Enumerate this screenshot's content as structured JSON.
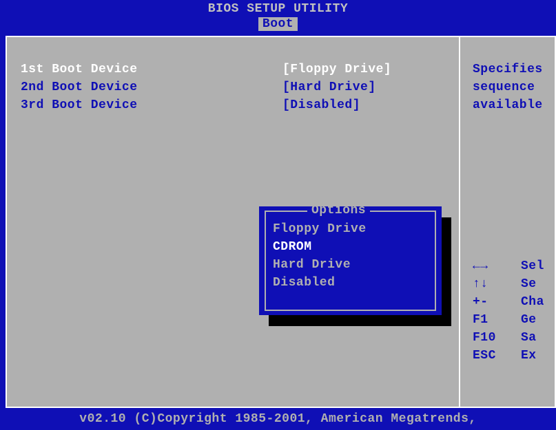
{
  "header": {
    "title": "BIOS SETUP UTILITY",
    "active_tab": "Boot"
  },
  "boot_devices": [
    {
      "label": "1st Boot Device",
      "value": "[Floppy Drive]",
      "selected": true
    },
    {
      "label": "2nd Boot Device",
      "value": "[Hard Drive]",
      "selected": false
    },
    {
      "label": "3rd Boot Device",
      "value": "[Disabled]",
      "selected": false
    }
  ],
  "options_popup": {
    "title": "Options",
    "items": [
      {
        "label": "Floppy Drive",
        "selected": false
      },
      {
        "label": "CDROM",
        "selected": true
      },
      {
        "label": "Hard Drive",
        "selected": false
      },
      {
        "label": "Disabled",
        "selected": false
      }
    ]
  },
  "help": {
    "lines": [
      "Specifies",
      "sequence",
      "available"
    ]
  },
  "keys": [
    {
      "sym": "←→",
      "desc": "Sel"
    },
    {
      "sym": "↑↓",
      "desc": "Se"
    },
    {
      "sym": "+-",
      "desc": "Cha"
    },
    {
      "sym": "F1",
      "desc": "Ge"
    },
    {
      "sym": "F10",
      "desc": "Sa"
    },
    {
      "sym": "ESC",
      "desc": "Ex"
    }
  ],
  "footer": "v02.10 (C)Copyright 1985-2001, American Megatrends,"
}
